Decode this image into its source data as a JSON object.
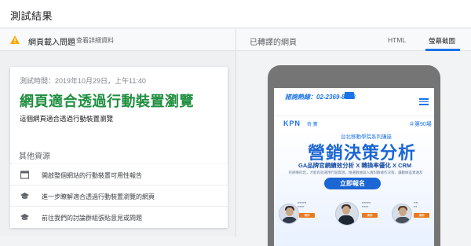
{
  "header": {
    "title": "測試結果"
  },
  "issue": {
    "title": "網頁載入問題",
    "link": "查看詳細資料"
  },
  "result": {
    "test_time": "測試時間：2019年10月29日，上午11:40",
    "headline": "網頁適合透過行動裝置瀏覽",
    "description": "這個網頁適合透過行動裝置瀏覽"
  },
  "other_resources": {
    "title": "其他資源",
    "items": [
      {
        "label": "開啟整個網站的行動裝置可用性報告",
        "icon": "report-icon"
      },
      {
        "label": "進一步瞭解適合透過行動裝置瀏覽的網頁",
        "icon": "school-icon"
      },
      {
        "label": "前往我們的討論群組張貼意見或問題",
        "icon": "school-icon"
      }
    ]
  },
  "right_panel": {
    "rendered_label": "已轉譯的網頁",
    "tabs": [
      {
        "label": "HTML",
        "selected": false
      },
      {
        "label": "螢幕截圖",
        "selected": true
      }
    ]
  },
  "screenshot": {
    "contact": "諮詢熱線：02-2369-8858",
    "brand": "KPN",
    "brand_sub": "奇 寶",
    "session": "＃第90場",
    "series": "台北移動學院系列講座",
    "big_title": "營銷決策分析",
    "subtitle": "GA品牌官網績效分析 X 轉換率優化 X CRM",
    "note": "有網事的您，才能有效運用行銷資源、精選數據與人員對數據作決策、讓數據差異遍及",
    "cta": "立即報名",
    "speaker_tags": [
      "講師",
      "講師",
      "講師"
    ]
  },
  "colors": {
    "accent": "#1a73e8",
    "success": "#1e8e3e",
    "warning": "#f9ab00"
  }
}
